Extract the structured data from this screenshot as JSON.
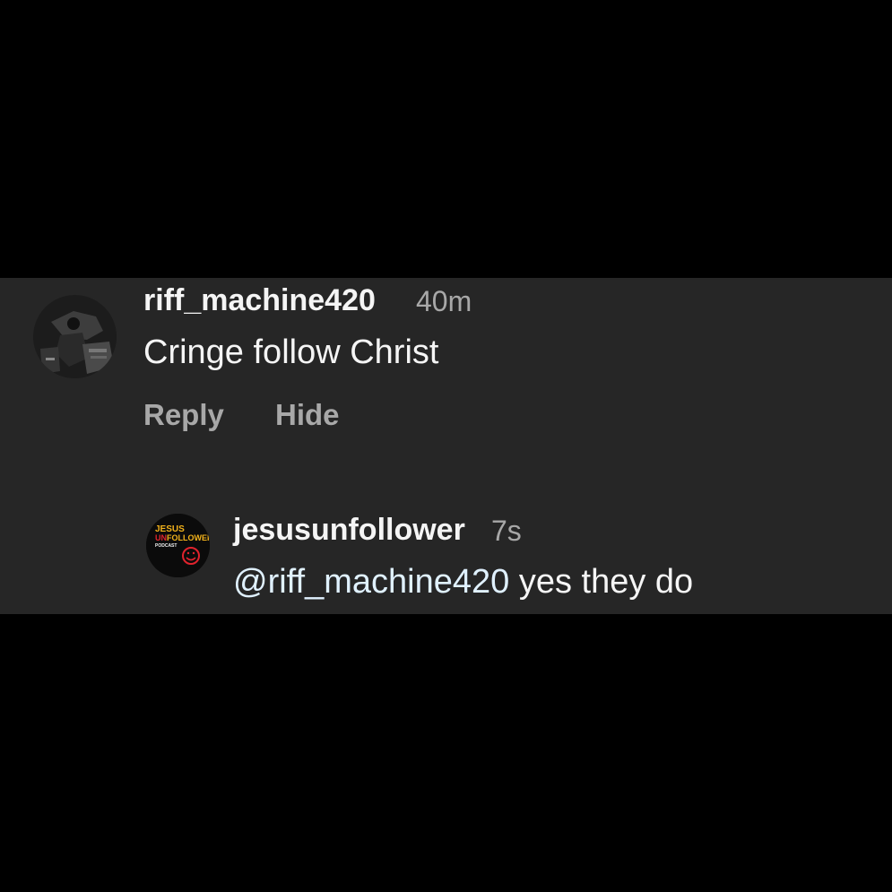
{
  "comment": {
    "username": "riff_machine420",
    "time": "40m",
    "text": "Cringe follow Christ",
    "actions": {
      "reply": "Reply",
      "hide": "Hide"
    }
  },
  "reply": {
    "username": "jesusunfollower",
    "time": "7s",
    "mention": "@riff_machine420",
    "text": " yes they do",
    "avatar_logo": {
      "line1": "JESUS",
      "line2a": "UN",
      "line2b": "FOLLOWER",
      "line3": "PODCAST"
    }
  },
  "colors": {
    "background": "#000000",
    "panel": "#262626",
    "primary_text": "#f5f5f5",
    "secondary_text": "#a8a8a8",
    "mention": "#e0f1ff",
    "logo_yellow": "#f2b21b",
    "logo_red": "#e0232d"
  }
}
